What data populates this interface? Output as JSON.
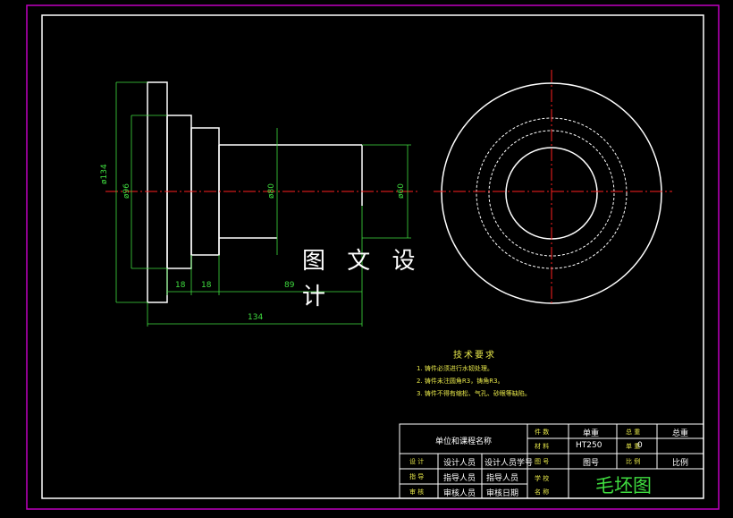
{
  "watermark": "图 文 设 计",
  "dimensions": {
    "d134": "ø134",
    "d96": "ø96",
    "d80": "ø80",
    "d60": "ø60",
    "l18a": "18",
    "l18b": "18",
    "l89": "89",
    "l134": "134"
  },
  "technical_requirements": {
    "title": "技术要求",
    "items": [
      "1. 铸件必须进行水韧处理。",
      "2. 铸件未注圆角R3，铸角R3。",
      "3. 铸件不得有缩松、气孔、砂眼等缺陷。"
    ]
  },
  "title_block": {
    "org": "单位和课程名称",
    "qty_label": "件 数",
    "qty_value": "单重",
    "total_label": "总 重",
    "total_value": "总重",
    "material_label": "材 料",
    "material_value": "HT250",
    "weight_label": "单 重",
    "weight_value": "0",
    "drawing_no_label": "图 号",
    "drawing_no_value": "图号",
    "scale_label": "比 例",
    "scale_value": "比例",
    "design_label": "设 计",
    "design_person": "设计人员",
    "design_id": "设计人员学号",
    "guide_label": "指 导",
    "guide_person": "指导人员",
    "guide_person2": "指导人员",
    "review_label": "审 核",
    "review_person": "审核人员",
    "review_date": "审核日期",
    "school_label": "学 校",
    "name_label": "名 称",
    "drawing_name": "毛坯图"
  },
  "colors": {
    "frame": "#c000c0",
    "border": "#ffffff",
    "dimension": "#3fdc3f",
    "center": "#ff2020",
    "text_yellow": "#e8e84a"
  }
}
